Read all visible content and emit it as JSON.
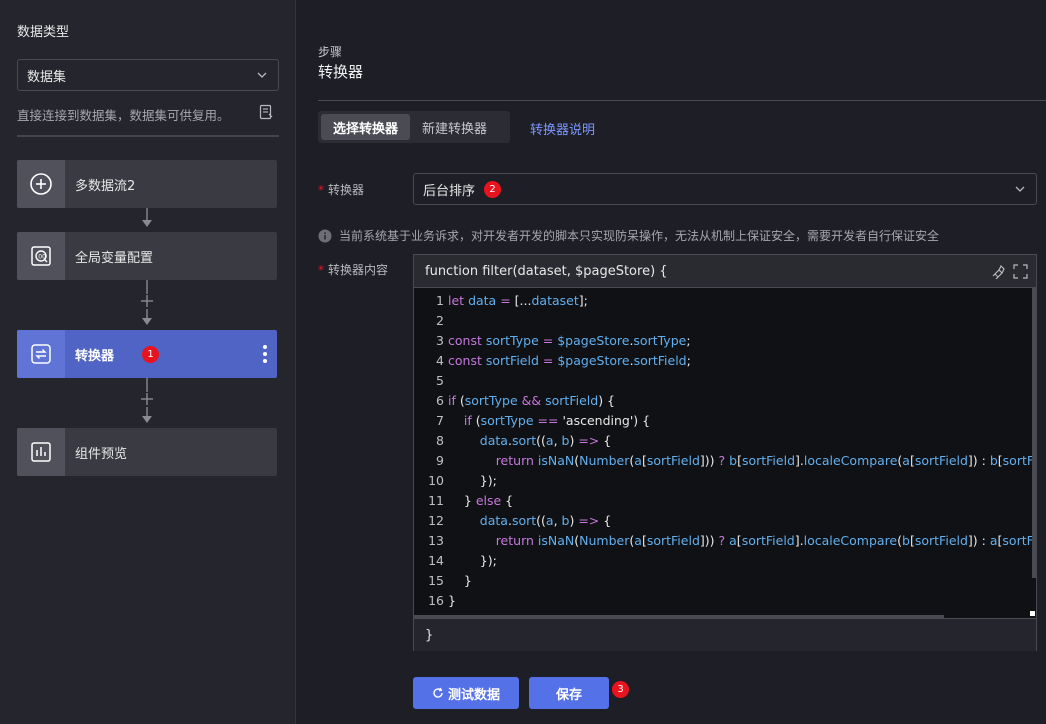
{
  "sidebar": {
    "title": "数据类型",
    "select_value": "数据集",
    "hint": "直接连接到数据集，数据集可供复用。",
    "nodes": [
      {
        "label": "多数据流2",
        "icon": "plus-circle-icon"
      },
      {
        "label": "全局变量配置",
        "icon": "global-variable-icon"
      },
      {
        "label": "转换器",
        "icon": "transform-icon",
        "badge": "1"
      },
      {
        "label": "组件预览",
        "icon": "chart-preview-icon"
      }
    ]
  },
  "main": {
    "step_small": "步骤",
    "step_title": "转换器",
    "tabs": [
      {
        "label": "选择转换器",
        "active": true
      },
      {
        "label": "新建转换器",
        "active": false
      }
    ],
    "doc_link": "转换器说明",
    "converter_label": "转换器",
    "converter_value": "后台排序",
    "converter_badge": "2",
    "info_text": "当前系统基于业务诉求，对开发者开发的脚本只实现防呆操作，无法从机制上保证安全，需要开发者自行保证安全",
    "content_label": "转换器内容",
    "editor_header": "function filter(dataset, $pageStore) {",
    "editor_footer": "}",
    "test_button": "测试数据",
    "save_button": "保存",
    "save_badge": "3"
  },
  "colors": {
    "accent": "#5571e8",
    "active_node": "#4f64c4",
    "badge": "#e8131f",
    "link": "#7d96ff"
  }
}
